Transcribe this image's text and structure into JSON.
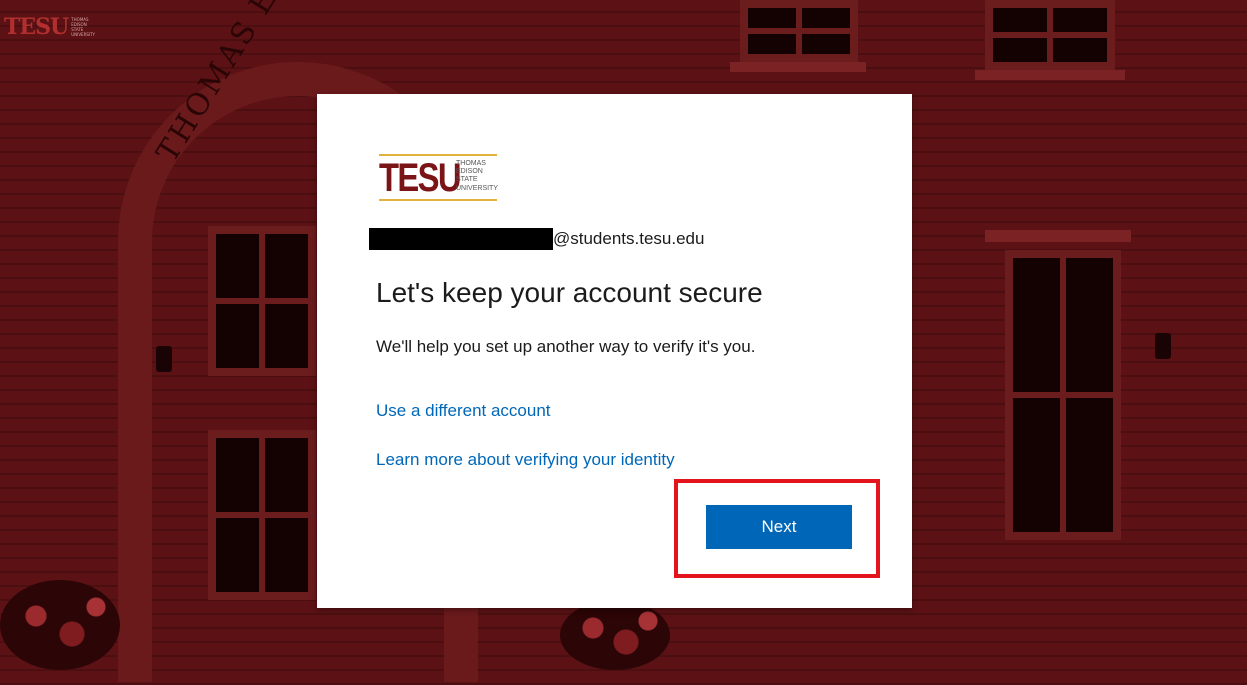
{
  "corner_logo": {
    "mark": "TESU",
    "lines": [
      "THOMAS",
      "EDISON",
      "STATE",
      "UNIVERSITY"
    ]
  },
  "background": {
    "arch_text": "THOMAS EDISON ST"
  },
  "card": {
    "brand": {
      "mark": "TESU",
      "lines": [
        "THOMAS",
        "EDISON",
        "STATE",
        "UNIVERSITY"
      ]
    },
    "identity": {
      "email_suffix": "@students.tesu.edu"
    },
    "title": "Let's keep your account secure",
    "description": "We'll help you set up another way to verify it's you.",
    "links": {
      "different_account": "Use a different account",
      "learn_more": "Learn more about verifying your identity"
    },
    "next_label": "Next"
  },
  "colors": {
    "brand_red": "#7b1416",
    "link_blue": "#0067b8",
    "button_blue": "#0067b8",
    "highlight_red": "#e3141b",
    "gold": "#e2b23a"
  }
}
